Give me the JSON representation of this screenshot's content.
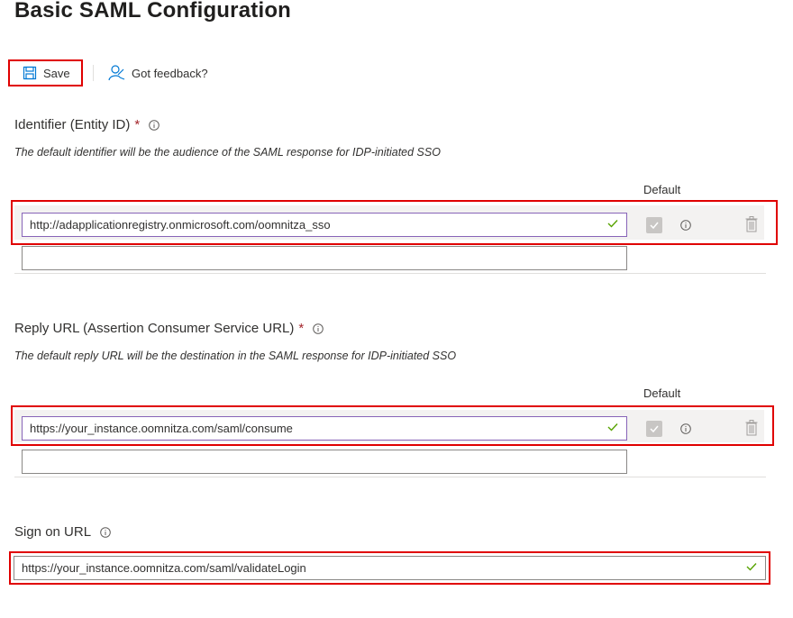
{
  "page": {
    "title": "Basic SAML Configuration"
  },
  "toolbar": {
    "save_label": "Save",
    "feedback_label": "Got feedback?"
  },
  "identifier": {
    "label": "Identifier (Entity ID)",
    "required": "*",
    "description": "The default identifier will be the audience of the SAML response for IDP-initiated SSO",
    "default_header": "Default",
    "values": [
      "http://adapplicationregistry.onmicrosoft.com/oomnitza_sso",
      ""
    ]
  },
  "reply_url": {
    "label": "Reply URL (Assertion Consumer Service URL)",
    "required": "*",
    "description": "The default reply URL will be the destination in the SAML response for IDP-initiated SSO",
    "default_header": "Default",
    "values": [
      "https://your_instance.oomnitza.com/saml/consume",
      ""
    ]
  },
  "sign_on": {
    "label": "Sign on URL",
    "value": "https://your_instance.oomnitza.com/saml/validateLogin"
  },
  "colors": {
    "highlight": "#e00000",
    "focus": "#8764b8",
    "check": "#57a300",
    "required": "#a4262c"
  }
}
